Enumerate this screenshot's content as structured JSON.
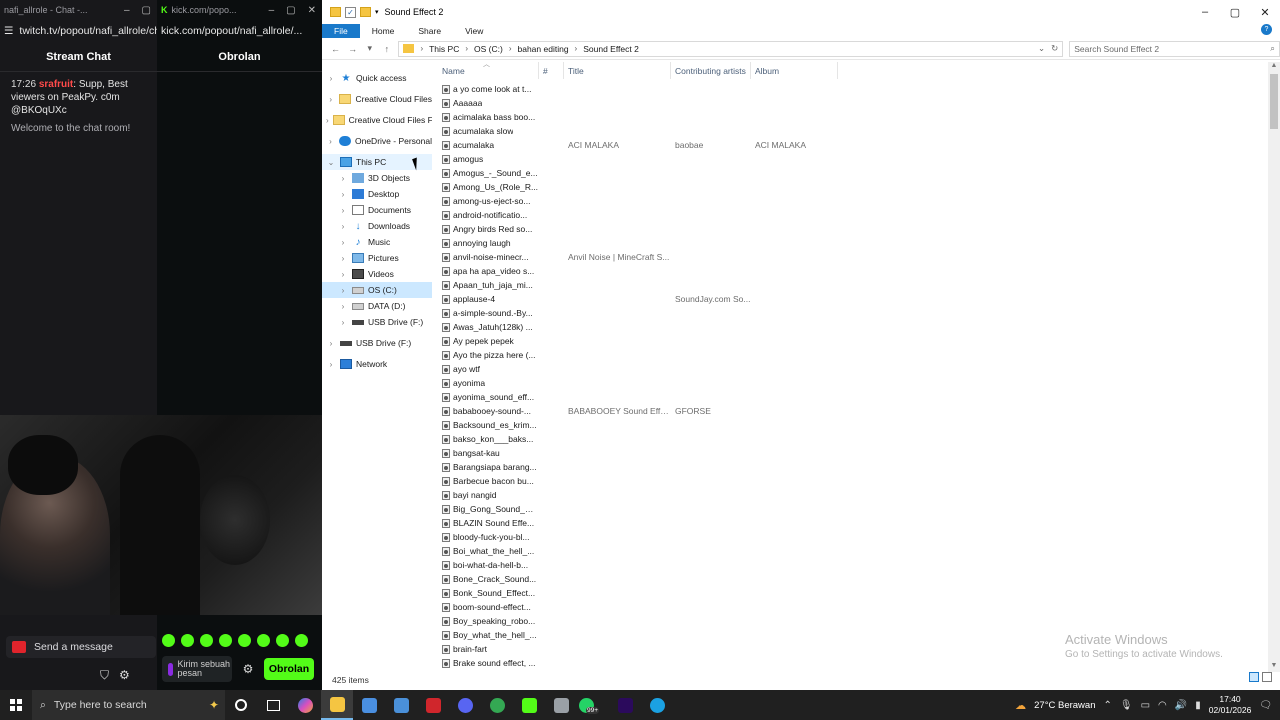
{
  "twitch": {
    "tab_title": "nafi_allrole - Chat -...",
    "url": "twitch.tv/popout/nafi_allrole/ch",
    "header": "Stream Chat",
    "message": {
      "time": "17:26",
      "user": "srafruit",
      "text": ": Supp, Best viewers on PeakPy. c0m",
      "mention": "@BKOqUXc"
    },
    "welcome": "Welcome to the chat room!",
    "send_placeholder": "Send a message"
  },
  "kick": {
    "tab_title": "kick.com/popo...",
    "url": "kick.com/popout/nafi_allrole/...",
    "header": "Obrolan",
    "mic_label": "Kirim sebuah pesan",
    "send_label": "Obrolan"
  },
  "explorer": {
    "window_title": "Sound Effect 2",
    "ribbon_tabs": [
      "File",
      "Home",
      "Share",
      "View"
    ],
    "breadcrumb": [
      "This PC",
      "OS (C:)",
      "bahan editing",
      "Sound Effect 2"
    ],
    "search_placeholder": "Search Sound Effect 2",
    "nav": [
      {
        "label": "Quick access",
        "icon": "star-icon",
        "indent": 0
      },
      {
        "label": "Creative Cloud Files",
        "icon": "folder-icon",
        "indent": 0
      },
      {
        "label": "Creative Cloud Files F",
        "icon": "folder-icon",
        "indent": 0
      },
      {
        "label": "OneDrive - Personal",
        "icon": "cloud-icon",
        "indent": 0
      },
      {
        "label": "This PC",
        "icon": "pc-icon",
        "indent": 0,
        "expanded": true
      },
      {
        "label": "3D Objects",
        "icon": "3d-objects-icon",
        "indent": 1
      },
      {
        "label": "Desktop",
        "icon": "desktop-icon",
        "indent": 1
      },
      {
        "label": "Documents",
        "icon": "documents-icon",
        "indent": 1
      },
      {
        "label": "Downloads",
        "icon": "downloads-icon",
        "indent": 1
      },
      {
        "label": "Music",
        "icon": "music-icon",
        "indent": 1
      },
      {
        "label": "Pictures",
        "icon": "pictures-icon",
        "indent": 1
      },
      {
        "label": "Videos",
        "icon": "videos-icon",
        "indent": 1
      },
      {
        "label": "OS (C:)",
        "icon": "drive-icon",
        "indent": 1,
        "selected": true
      },
      {
        "label": "DATA (D:)",
        "icon": "drive-icon",
        "indent": 1
      },
      {
        "label": "USB Drive (F:)",
        "icon": "usb-drive-icon",
        "indent": 1
      },
      {
        "label": "USB Drive (F:)",
        "icon": "usb-drive-icon",
        "indent": 0
      },
      {
        "label": "Network",
        "icon": "network-icon",
        "indent": 0
      }
    ],
    "columns": [
      "Name",
      "#",
      "Title",
      "Contributing artists",
      "Album"
    ],
    "files": [
      {
        "name": "a yo come look at t...",
        "num": "",
        "title": "",
        "artist": "",
        "album": ""
      },
      {
        "name": "Aaaaaa",
        "num": "",
        "title": "",
        "artist": "",
        "album": ""
      },
      {
        "name": "acimalaka bass boo...",
        "num": "",
        "title": "",
        "artist": "",
        "album": ""
      },
      {
        "name": "acumalaka slow",
        "num": "",
        "title": "",
        "artist": "",
        "album": ""
      },
      {
        "name": "acumalaka",
        "num": "",
        "title": "ACI MALAKA",
        "artist": "baobae",
        "album": "ACI MALAKA"
      },
      {
        "name": "amogus",
        "num": "",
        "title": "",
        "artist": "",
        "album": ""
      },
      {
        "name": "Amogus_-_Sound_e...",
        "num": "",
        "title": "",
        "artist": "",
        "album": ""
      },
      {
        "name": "Among_Us_(Role_R...",
        "num": "",
        "title": "",
        "artist": "",
        "album": ""
      },
      {
        "name": "among-us-eject-so...",
        "num": "",
        "title": "",
        "artist": "",
        "album": ""
      },
      {
        "name": "android-notificatio...",
        "num": "",
        "title": "",
        "artist": "",
        "album": ""
      },
      {
        "name": "Angry birds Red so...",
        "num": "",
        "title": "",
        "artist": "",
        "album": ""
      },
      {
        "name": "annoying laugh",
        "num": "",
        "title": "",
        "artist": "",
        "album": ""
      },
      {
        "name": "anvil-noise-minecr...",
        "num": "",
        "title": "Anvil Noise | MineCraft S...",
        "artist": "",
        "album": ""
      },
      {
        "name": "apa ha apa_video s...",
        "num": "",
        "title": "",
        "artist": "",
        "album": ""
      },
      {
        "name": "Apaan_tuh_jaja_mi...",
        "num": "",
        "title": "",
        "artist": "",
        "album": ""
      },
      {
        "name": "applause-4",
        "num": "",
        "title": "",
        "artist": "SoundJay.com So...",
        "album": ""
      },
      {
        "name": "a-simple-sound.-By...",
        "num": "",
        "title": "",
        "artist": "",
        "album": ""
      },
      {
        "name": "Awas_Jatuh(128k) ...",
        "num": "",
        "title": "",
        "artist": "",
        "album": ""
      },
      {
        "name": "Ay pepek pepek",
        "num": "",
        "title": "",
        "artist": "",
        "album": ""
      },
      {
        "name": "Ayo the pizza here (...",
        "num": "",
        "title": "",
        "artist": "",
        "album": ""
      },
      {
        "name": "ayo wtf",
        "num": "",
        "title": "",
        "artist": "",
        "album": ""
      },
      {
        "name": "ayonima",
        "num": "",
        "title": "",
        "artist": "",
        "album": ""
      },
      {
        "name": "ayonima_sound_eff...",
        "num": "",
        "title": "",
        "artist": "",
        "album": ""
      },
      {
        "name": "bababooey-sound-...",
        "num": "",
        "title": "BABABOOEY Sound Effect",
        "artist": "GFORSE",
        "album": ""
      },
      {
        "name": "Backsound_es_krim...",
        "num": "",
        "title": "",
        "artist": "",
        "album": ""
      },
      {
        "name": "bakso_kon___baks...",
        "num": "",
        "title": "",
        "artist": "",
        "album": ""
      },
      {
        "name": "bangsat-kau",
        "num": "",
        "title": "",
        "artist": "",
        "album": ""
      },
      {
        "name": "Barangsiapa barang...",
        "num": "",
        "title": "",
        "artist": "",
        "album": ""
      },
      {
        "name": "Barbecue bacon bu...",
        "num": "",
        "title": "",
        "artist": "",
        "album": ""
      },
      {
        "name": "bayi nangid",
        "num": "",
        "title": "",
        "artist": "",
        "album": ""
      },
      {
        "name": "Big_Gong_Sound_Ef...",
        "num": "",
        "title": "",
        "artist": "",
        "album": ""
      },
      {
        "name": "BLAZIN Sound Effe...",
        "num": "",
        "title": "",
        "artist": "",
        "album": ""
      },
      {
        "name": "bloody-fuck-you-bl...",
        "num": "",
        "title": "",
        "artist": "",
        "album": ""
      },
      {
        "name": "Boi_what_the_hell_...",
        "num": "",
        "title": "",
        "artist": "",
        "album": ""
      },
      {
        "name": "boi-what-da-hell-b...",
        "num": "",
        "title": "",
        "artist": "",
        "album": ""
      },
      {
        "name": "Bone_Crack_Sound...",
        "num": "",
        "title": "",
        "artist": "",
        "album": ""
      },
      {
        "name": "Bonk_Sound_Effect...",
        "num": "",
        "title": "",
        "artist": "",
        "album": ""
      },
      {
        "name": "boom-sound-effect...",
        "num": "",
        "title": "",
        "artist": "",
        "album": ""
      },
      {
        "name": "Boy_speaking_robo...",
        "num": "",
        "title": "",
        "artist": "",
        "album": ""
      },
      {
        "name": "Boy_what_the_hell_...",
        "num": "",
        "title": "",
        "artist": "",
        "album": ""
      },
      {
        "name": "brain-fart",
        "num": "",
        "title": "",
        "artist": "",
        "album": ""
      },
      {
        "name": "Brake sound effect, ...",
        "num": "",
        "title": "",
        "artist": "",
        "album": ""
      }
    ],
    "status": "425 items",
    "watermark_line1": "Activate Windows",
    "watermark_line2": "Go to Settings to activate Windows."
  },
  "taskbar": {
    "search_placeholder": "Type here to search",
    "apps": [
      {
        "name": "file-explorer-icon",
        "color": "#f5c542",
        "active": true
      },
      {
        "name": "microsoft-store-icon",
        "color": "#4a8fe0"
      },
      {
        "name": "settings-app-icon",
        "color": "#4a90d9"
      },
      {
        "name": "roblox-icon",
        "color": "#d0262c"
      },
      {
        "name": "discord-icon",
        "color": "#5865f2"
      },
      {
        "name": "chrome-icon",
        "color": "#34a853"
      },
      {
        "name": "kick-app-icon",
        "color": "#53fc18"
      },
      {
        "name": "app-icon",
        "color": "#9aa0a6"
      },
      {
        "name": "whatsapp-icon",
        "color": "#25d366"
      },
      {
        "name": "premiere-pro-icon",
        "color": "#2b0a5c"
      },
      {
        "name": "edge-icon",
        "color": "#1ba1e2"
      }
    ],
    "whatsapp_badge": "99+",
    "weather": "27°C  Berawan",
    "time": "17:40",
    "date": "02/01/2026"
  }
}
